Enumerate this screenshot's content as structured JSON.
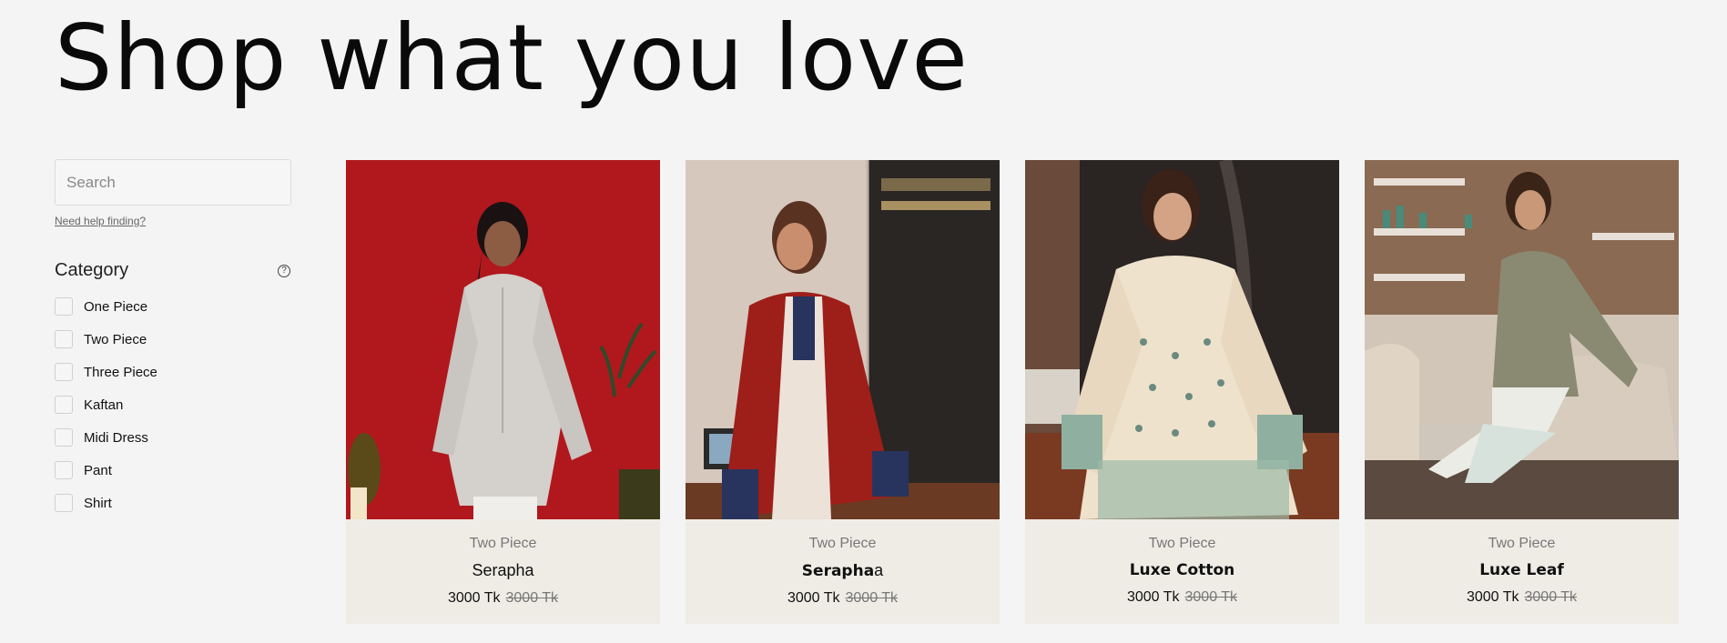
{
  "page": {
    "title": "Shop what you love"
  },
  "search": {
    "placeholder": "Search",
    "help_text": "Need help finding?"
  },
  "category": {
    "title": "Category",
    "items": [
      "One Piece",
      "Two Piece",
      "Three Piece",
      "Kaftan",
      "Midi Dress",
      "Pant",
      "Shirt"
    ]
  },
  "products": [
    {
      "category": "Two Piece",
      "name": "Serapha",
      "price": "3000 Tk",
      "old_price": "3000 Tk"
    },
    {
      "category": "Two Piece",
      "name": "Serapha",
      "name_suffix": "a",
      "price": "3000 Tk",
      "old_price": "3000 Tk"
    },
    {
      "category": "Two Piece",
      "name": "Luxe Cotton",
      "price": "3000 Tk",
      "old_price": "3000 Tk"
    },
    {
      "category": "Two Piece",
      "name": "Luxe Leaf",
      "price": "3000 Tk",
      "old_price": "3000 Tk"
    }
  ],
  "colors": {
    "background": "#f4f4f4",
    "card": "#efece6"
  }
}
